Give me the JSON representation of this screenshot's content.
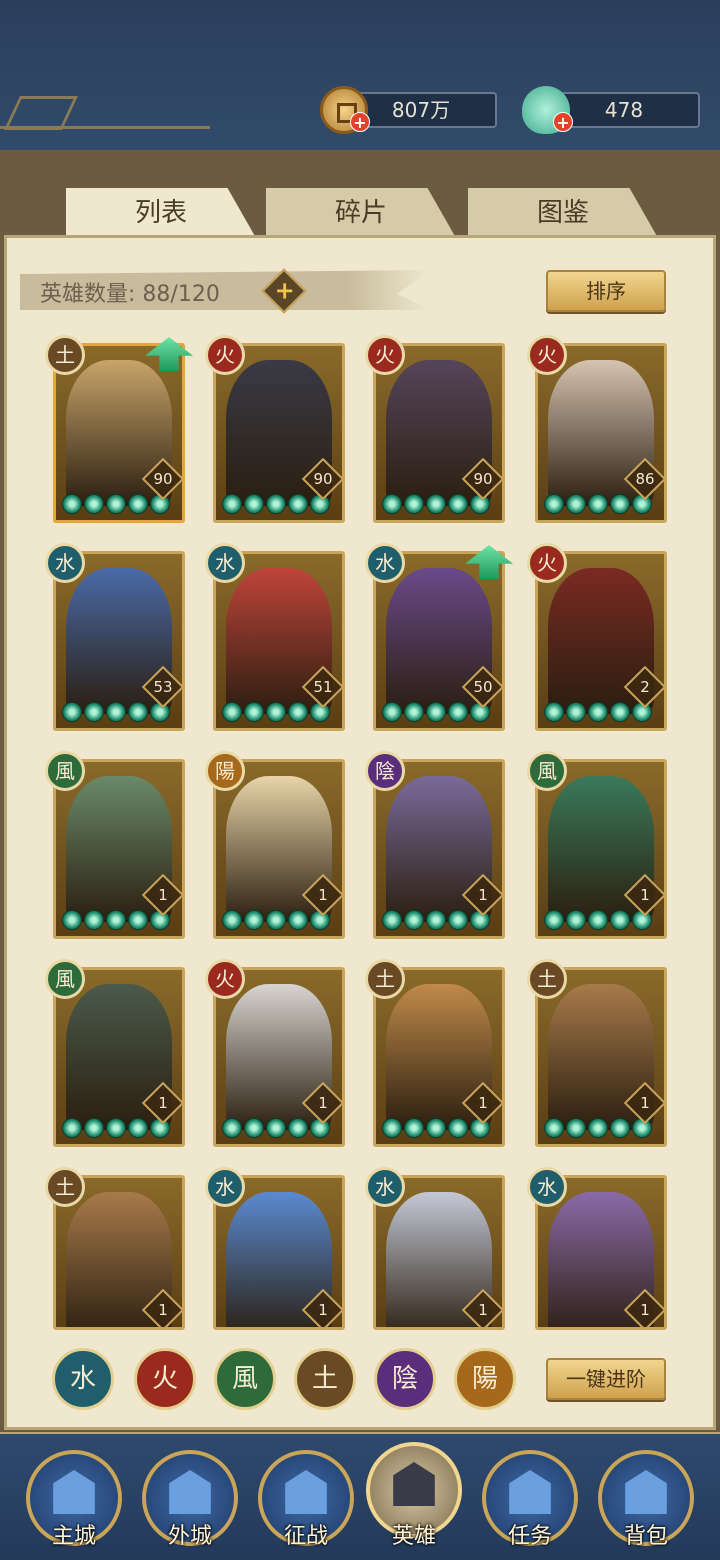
{
  "currency": {
    "coins": "807万",
    "gems": "478"
  },
  "tabs": [
    {
      "label": "列表",
      "active": true
    },
    {
      "label": "碎片",
      "active": false
    },
    {
      "label": "图鉴",
      "active": false
    }
  ],
  "hero_count": {
    "label": "英雄数量:",
    "value": "88/120"
  },
  "sort_button": "排序",
  "advance_button": "一键进阶",
  "heroes": [
    {
      "element": "土",
      "level": "90",
      "upgrade": true
    },
    {
      "element": "火",
      "level": "90",
      "upgrade": false
    },
    {
      "element": "火",
      "level": "90",
      "upgrade": false
    },
    {
      "element": "火",
      "level": "86",
      "upgrade": false
    },
    {
      "element": "水",
      "level": "53",
      "upgrade": false
    },
    {
      "element": "水",
      "level": "51",
      "upgrade": false
    },
    {
      "element": "水",
      "level": "50",
      "upgrade": true
    },
    {
      "element": "火",
      "level": "2",
      "upgrade": false
    },
    {
      "element": "風",
      "level": "1",
      "upgrade": false
    },
    {
      "element": "陽",
      "level": "1",
      "upgrade": false
    },
    {
      "element": "陰",
      "level": "1",
      "upgrade": false
    },
    {
      "element": "風",
      "level": "1",
      "upgrade": false
    },
    {
      "element": "風",
      "level": "1",
      "upgrade": false
    },
    {
      "element": "火",
      "level": "1",
      "upgrade": false
    },
    {
      "element": "土",
      "level": "1",
      "upgrade": false
    },
    {
      "element": "土",
      "level": "1",
      "upgrade": false
    },
    {
      "element": "土",
      "level": "1",
      "upgrade": false
    },
    {
      "element": "水",
      "level": "1",
      "upgrade": false
    },
    {
      "element": "水",
      "level": "1",
      "upgrade": false
    },
    {
      "element": "水",
      "level": "1",
      "upgrade": false
    }
  ],
  "element_filters": [
    "水",
    "火",
    "風",
    "土",
    "陰",
    "陽"
  ],
  "nav": [
    {
      "label": "主城",
      "active": false
    },
    {
      "label": "外城",
      "active": false
    },
    {
      "label": "征战",
      "active": false
    },
    {
      "label": "英雄",
      "active": true
    },
    {
      "label": "任务",
      "active": false
    },
    {
      "label": "背包",
      "active": false
    }
  ],
  "colors": {
    "panel": "#efe8cf",
    "gold": "#c9a55a",
    "navy": "#2f4563",
    "star": "#1f8c6c"
  }
}
